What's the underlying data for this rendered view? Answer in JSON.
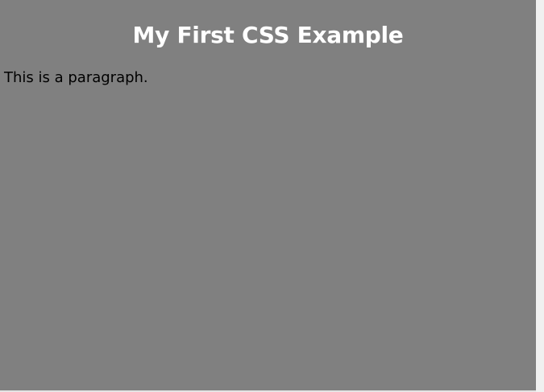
{
  "page": {
    "heading": "My First CSS Example",
    "paragraph": "This is a paragraph."
  },
  "colors": {
    "page_background": "#808080",
    "heading_text": "#ffffff",
    "paragraph_text": "#000000"
  }
}
